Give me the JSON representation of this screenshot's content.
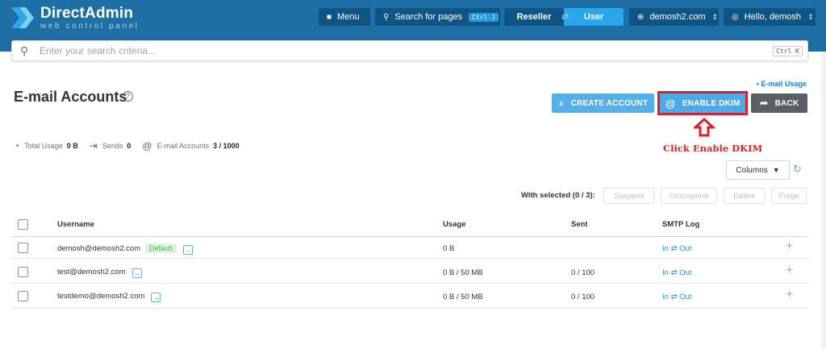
{
  "header": {
    "brand_title": "DirectAdmin",
    "brand_sub": "web control panel",
    "menu_label": "Menu",
    "search_pages_label": "Search for pages",
    "search_pages_kbd": "Ctrl J",
    "role_left": "Reseller",
    "role_right": "User",
    "domain": "demosh2.com",
    "greeting": "Hello, demosh"
  },
  "search": {
    "placeholder": "Enter your search criteria...",
    "shortcut": "Ctrl K"
  },
  "page": {
    "title": "E-mail Accounts",
    "usage_link": "• E-mail Usage",
    "create_label": "CREATE ACCOUNT",
    "dkim_label": "ENABLE DKIM",
    "back_label": "BACK",
    "annotation": "Click Enable DKIM"
  },
  "stats": {
    "total_usage_label": "Total Usage",
    "total_usage_value": "0 B",
    "sends_label": "Sends",
    "sends_value": "0",
    "accounts_label": "E-mail Accounts",
    "accounts_value": "3 / 1000"
  },
  "toolbar": {
    "columns_label": "Columns",
    "with_selected": "With selected (0 / 3):",
    "suspend": "Suspend",
    "unsuspend": "Unsuspend",
    "delete": "Delete",
    "purge": "Purge"
  },
  "table": {
    "headers": {
      "username": "Username",
      "usage": "Usage",
      "sent": "Sent",
      "smtp": "SMTP Log"
    },
    "rows": [
      {
        "username": "demosh@demosh2.com",
        "badge": "Default",
        "usage": "0 B",
        "sent": "",
        "smtp": "In ⇄ Out"
      },
      {
        "username": "test@demosh2.com",
        "badge": "",
        "usage": "0 B / 50 MB",
        "sent": "0 / 100",
        "smtp": "In ⇄ Out"
      },
      {
        "username": "testdemo@demosh2.com",
        "badge": "",
        "usage": "0 B / 50 MB",
        "sent": "0 / 100",
        "smtp": "In ⇄ Out"
      }
    ]
  },
  "colors": {
    "header_bg": "#1d6fa5",
    "accent": "#4aaaea",
    "annotation_red": "#d5232b"
  }
}
